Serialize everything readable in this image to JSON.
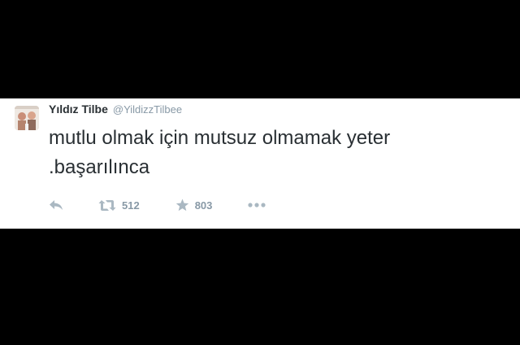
{
  "tweet": {
    "display_name": "Yıldız Tilbe",
    "handle": "@YildizzTilbee",
    "text": "mutlu olmak için mutsuz olmamak yeter\n.başarılınca",
    "retweet_count": "512",
    "favorite_count": "803"
  },
  "icons": {
    "reply": "reply-icon",
    "retweet": "retweet-icon",
    "favorite": "star-icon",
    "more": "more-dots-icon"
  },
  "colors": {
    "background": "#000000",
    "card": "#ffffff",
    "text": "#292f33",
    "muted": "#8899a6",
    "icon": "#aab8c2"
  }
}
